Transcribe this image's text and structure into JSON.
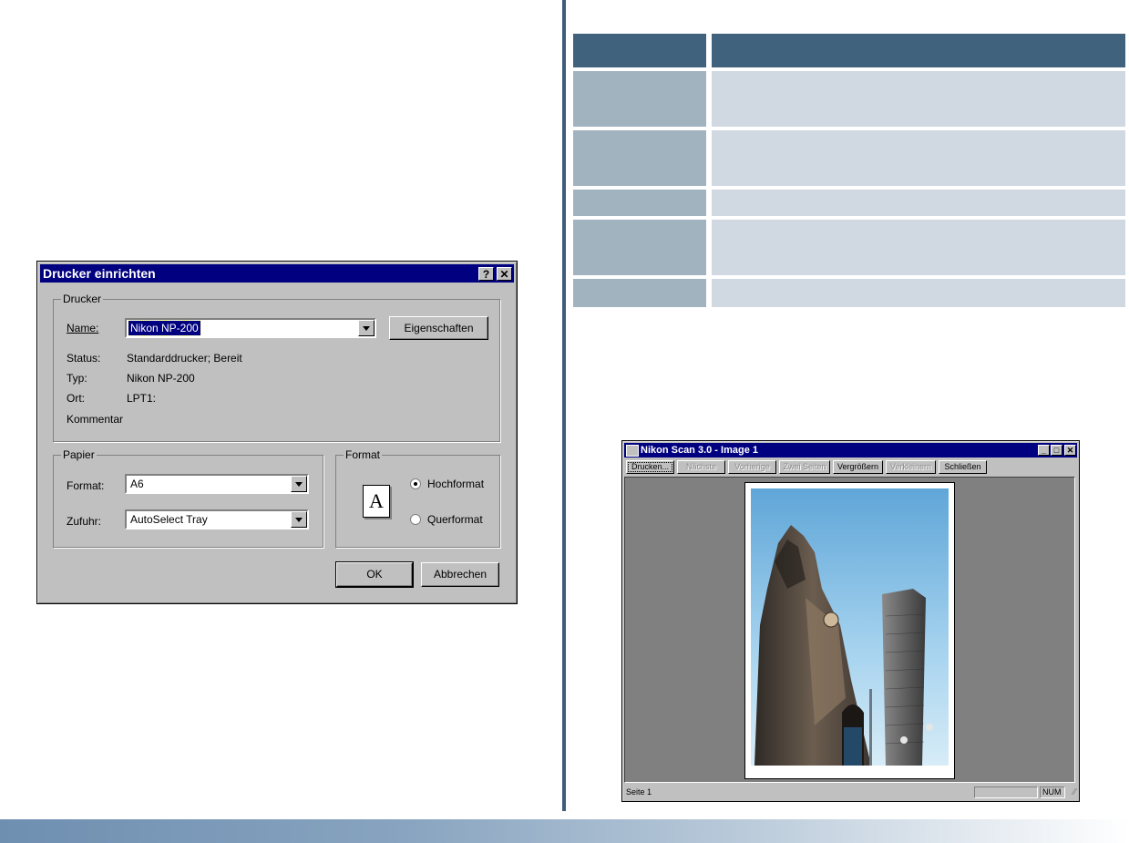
{
  "print_dialog": {
    "title": "Drucker einrichten",
    "help_button": "?",
    "close_button": "✕",
    "printer_group": "Drucker",
    "name_label": "Name:",
    "name_value": "Nikon NP-200",
    "properties_button": "Eigenschaften",
    "status_label": "Status:",
    "status_value": "Standarddrucker; Bereit",
    "type_label": "Typ:",
    "type_value": "Nikon NP-200",
    "location_label": "Ort:",
    "location_value": "LPT1:",
    "comment_label": "Kommentar",
    "paper_group": "Papier",
    "format_label": "Format:",
    "format_value": "A6",
    "source_label": "Zufuhr:",
    "source_value": "AutoSelect Tray",
    "orientation_group": "Format",
    "page_icon_letter": "A",
    "portrait_label": "Hochformat",
    "landscape_label": "Querformat",
    "portrait_selected": true,
    "ok_button": "OK",
    "cancel_button": "Abbrechen"
  },
  "table": {
    "row_count": 5
  },
  "nikon_window": {
    "title": "Nikon Scan 3.0 - Image 1",
    "minimize": "_",
    "maximize": "□",
    "close": "✕",
    "toolbar": {
      "print": "Drucken...",
      "next": "Nächste",
      "previous": "Vorherige",
      "two_pages": "Zwei Seiten",
      "zoom_in": "Vergrößern",
      "zoom_out": "Verkleinern",
      "close": "Schließen"
    },
    "status_page": "Seite 1",
    "status_num": "NUM"
  },
  "colors": {
    "divider": "#3f5d7a",
    "table_header": "#41627d",
    "table_first_col": "#a2b3c0",
    "table_second_col": "#d0d9e1",
    "titlebar": "#000080"
  }
}
